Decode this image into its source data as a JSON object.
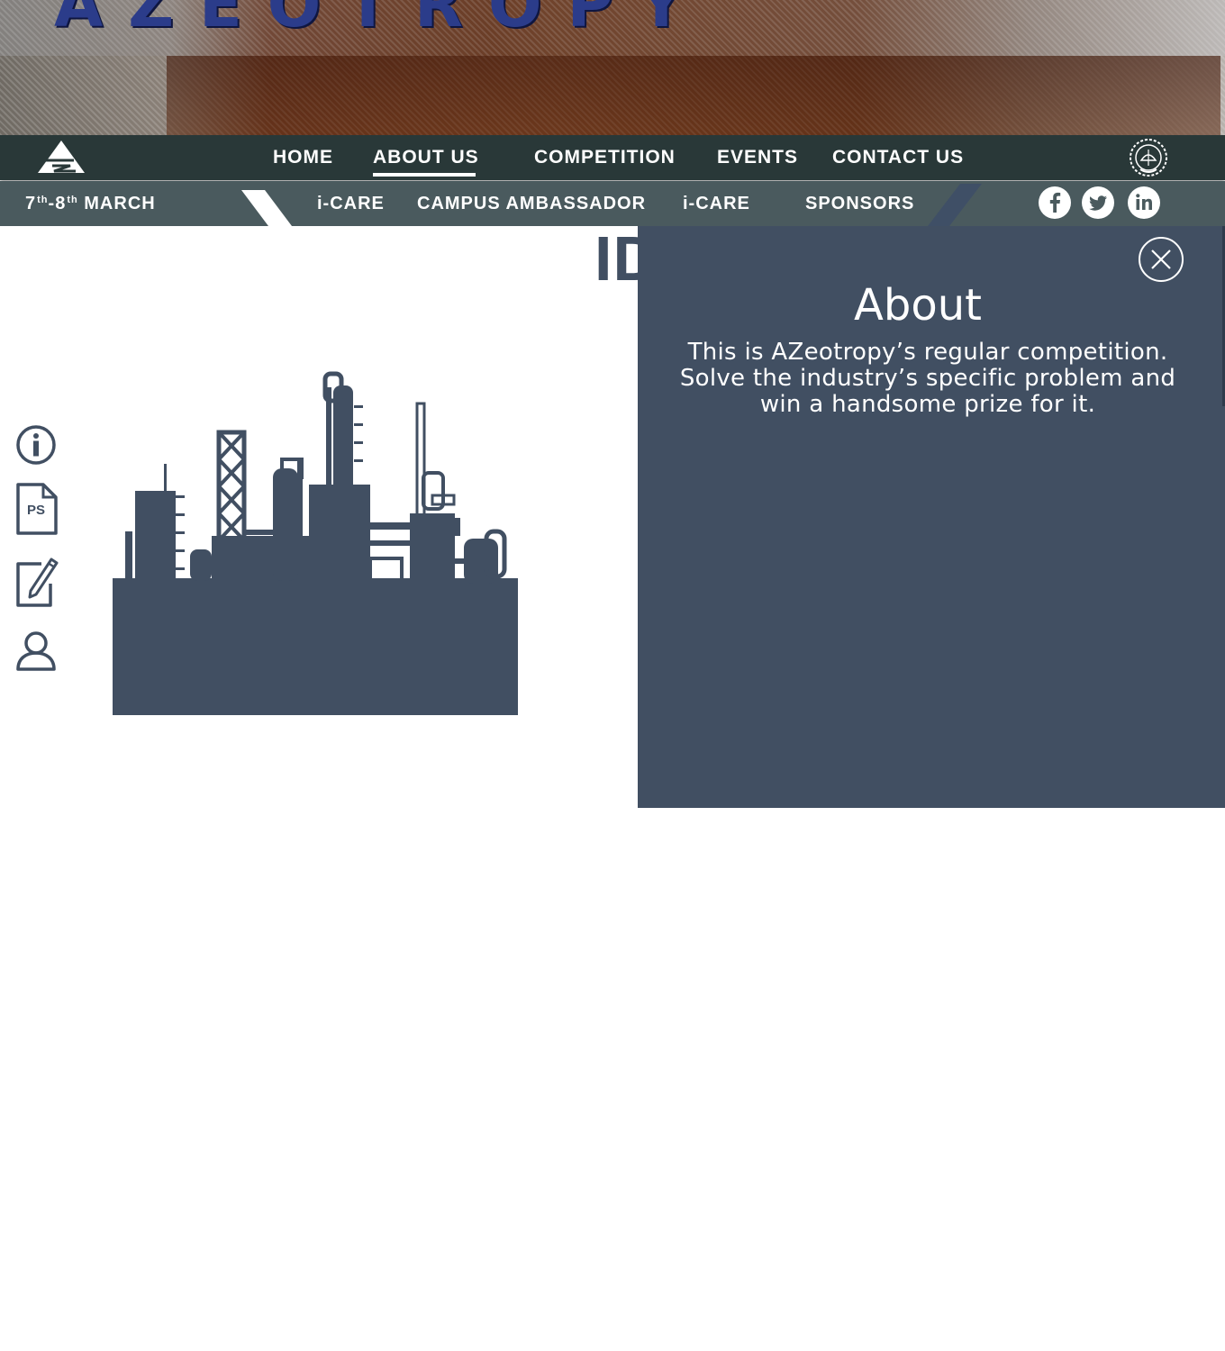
{
  "hero": {
    "banner_text": "AZEOTROPY"
  },
  "nav": {
    "items": [
      {
        "label": "HOME"
      },
      {
        "label": "ABOUT US",
        "active": true
      },
      {
        "label": "COMPETITION"
      },
      {
        "label": "EVENTS"
      },
      {
        "label": "CONTACT US"
      }
    ]
  },
  "subnav": {
    "date": {
      "start": "7",
      "start_sup": "th",
      "sep": "-",
      "end": "8",
      "end_sup": "th",
      "month": "MARCH"
    },
    "items": [
      {
        "label": "i-CARE"
      },
      {
        "label": "CAMPUS AMBASSADOR"
      },
      {
        "label": "i-CARE"
      },
      {
        "label": "SPONSORS"
      }
    ],
    "social": [
      {
        "icon": "facebook-icon",
        "glyph": "f"
      },
      {
        "icon": "twitter-icon",
        "glyph": "t"
      },
      {
        "icon": "linkedin-icon",
        "glyph": "in"
      }
    ]
  },
  "page": {
    "title": "IDP"
  },
  "sidebar": {
    "icons": [
      {
        "icon": "info-icon"
      },
      {
        "icon": "problem-statement-icon",
        "label": "PS"
      },
      {
        "icon": "register-edit-icon"
      },
      {
        "icon": "user-icon"
      }
    ]
  },
  "about": {
    "heading": "About",
    "text": "This is AZeotropy’s regular competition. Solve the industry’s specific problem and win a handsome prize for it."
  },
  "colors": {
    "nav_bg": "#293838",
    "subnav_bg": "#4a5a5e",
    "accent_slate": "#414f62",
    "text_light": "#ffffff"
  }
}
